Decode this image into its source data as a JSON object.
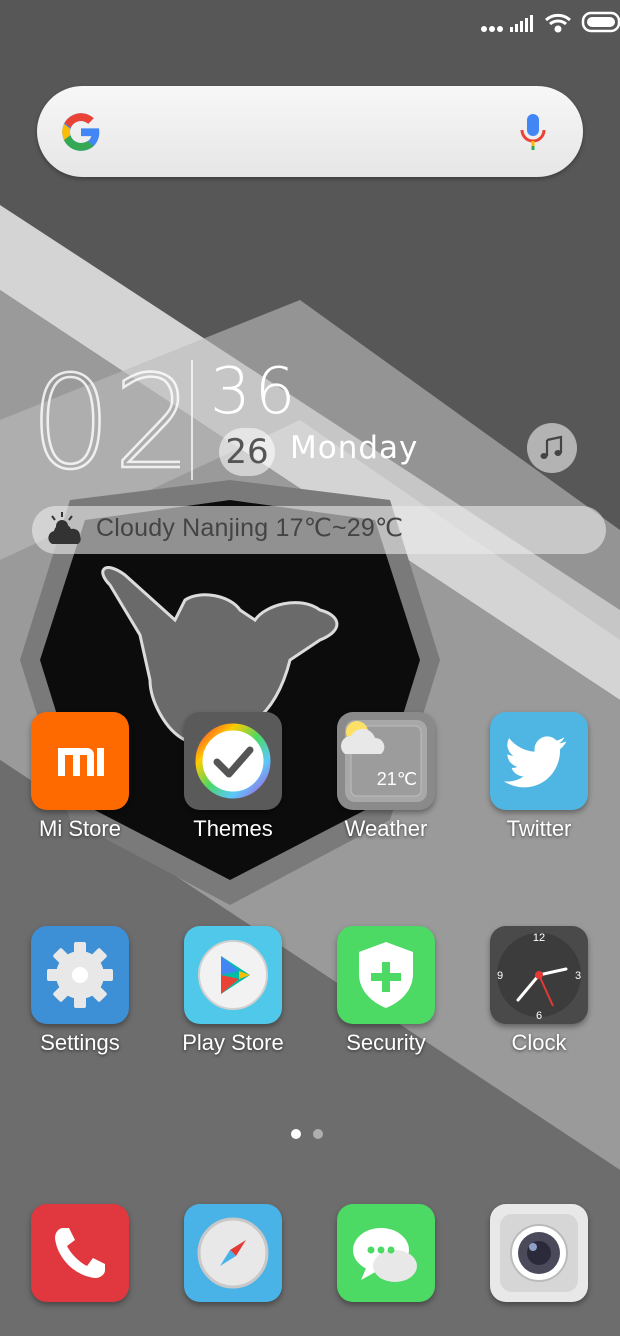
{
  "status_bar": {
    "icons": [
      "more-dots-icon",
      "signal-icon",
      "wifi-icon",
      "battery-icon"
    ]
  },
  "search": {
    "icons": [
      "google-g-icon",
      "mic-icon"
    ]
  },
  "clock_widget": {
    "hours": "02",
    "minutes": "36",
    "date": "26",
    "day": "Monday",
    "music_icon": "music-note-icon"
  },
  "weather_widget": {
    "icon": "cloud-sun-icon",
    "text": "Cloudy Nanjing 17℃~29℃"
  },
  "apps_row1": [
    {
      "label": "Mi Store",
      "icon": "mi-store-icon",
      "color": "#ff6a00"
    },
    {
      "label": "Themes",
      "icon": "themes-icon",
      "color": "#555555"
    },
    {
      "label": "Weather",
      "icon": "weather-icon",
      "temp": "21℃"
    },
    {
      "label": "Twitter",
      "icon": "twitter-icon",
      "color": "#4fb6e3"
    }
  ],
  "apps_row2": [
    {
      "label": "Settings",
      "icon": "settings-icon",
      "color": "#3d8fd6"
    },
    {
      "label": "Play Store",
      "icon": "play-store-icon",
      "color": "#4fc8ea"
    },
    {
      "label": "Security",
      "icon": "security-icon",
      "color": "#4cd964"
    },
    {
      "label": "Clock",
      "icon": "clock-icon",
      "color": "#4a4a4a",
      "dial": [
        "12",
        "3",
        "6",
        "9"
      ]
    }
  ],
  "page_indicator": {
    "current": 1,
    "total": 2
  },
  "dock": [
    {
      "icon": "phone-icon",
      "color": "#e0383e"
    },
    {
      "icon": "browser-icon",
      "color": "#49b3e8"
    },
    {
      "icon": "messages-icon",
      "color": "#4cd964"
    },
    {
      "icon": "camera-icon",
      "color": "#e8e8e8"
    }
  ]
}
